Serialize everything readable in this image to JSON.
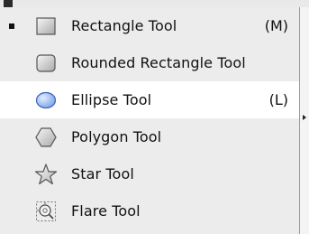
{
  "menu": {
    "items": [
      {
        "label": "Rectangle Tool",
        "shortcut": "(M)",
        "icon": "rectangle-icon",
        "selected": true
      },
      {
        "label": "Rounded Rectangle Tool",
        "shortcut": "",
        "icon": "rounded-rectangle-icon",
        "selected": false
      },
      {
        "label": "Ellipse Tool",
        "shortcut": "(L)",
        "icon": "ellipse-icon",
        "selected": false
      },
      {
        "label": "Polygon Tool",
        "shortcut": "",
        "icon": "polygon-icon",
        "selected": false
      },
      {
        "label": "Star Tool",
        "shortcut": "",
        "icon": "star-icon",
        "selected": false
      },
      {
        "label": "Flare Tool",
        "shortcut": "",
        "icon": "flare-icon",
        "selected": false
      }
    ]
  },
  "colors": {
    "menu_bg": "#ececec",
    "hover_bg": "#ffffff",
    "text": "#111111",
    "ellipse_fill": "#8fb5f2",
    "ellipse_stroke": "#3d63b8"
  }
}
